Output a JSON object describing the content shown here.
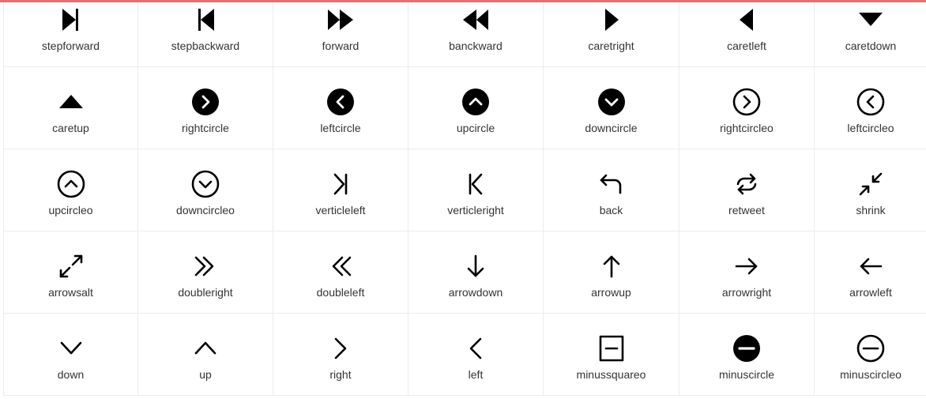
{
  "accent_color": "#ee6b6e",
  "icon_color": "#000000",
  "label_color": "#333333",
  "icons": [
    {
      "label": "stepforward",
      "icon": "step-forward-icon"
    },
    {
      "label": "stepbackward",
      "icon": "step-backward-icon"
    },
    {
      "label": "forward",
      "icon": "forward-icon"
    },
    {
      "label": "banckward",
      "icon": "backward-icon"
    },
    {
      "label": "caretright",
      "icon": "caret-right-icon"
    },
    {
      "label": "caretleft",
      "icon": "caret-left-icon"
    },
    {
      "label": "caretdown",
      "icon": "caret-down-icon"
    },
    {
      "label": "caretup",
      "icon": "caret-up-icon"
    },
    {
      "label": "rightcircle",
      "icon": "right-circle-icon"
    },
    {
      "label": "leftcircle",
      "icon": "left-circle-icon"
    },
    {
      "label": "upcircle",
      "icon": "up-circle-icon"
    },
    {
      "label": "downcircle",
      "icon": "down-circle-icon"
    },
    {
      "label": "rightcircleo",
      "icon": "right-circle-outline-icon"
    },
    {
      "label": "leftcircleo",
      "icon": "left-circle-outline-icon"
    },
    {
      "label": "upcircleo",
      "icon": "up-circle-outline-icon"
    },
    {
      "label": "downcircleo",
      "icon": "down-circle-outline-icon"
    },
    {
      "label": "verticleleft",
      "icon": "vertical-left-icon"
    },
    {
      "label": "verticleright",
      "icon": "vertical-right-icon"
    },
    {
      "label": "back",
      "icon": "back-icon"
    },
    {
      "label": "retweet",
      "icon": "retweet-icon"
    },
    {
      "label": "shrink",
      "icon": "shrink-icon"
    },
    {
      "label": "arrowsalt",
      "icon": "arrows-alt-icon"
    },
    {
      "label": "doubleright",
      "icon": "double-right-icon"
    },
    {
      "label": "doubleleft",
      "icon": "double-left-icon"
    },
    {
      "label": "arrowdown",
      "icon": "arrow-down-icon"
    },
    {
      "label": "arrowup",
      "icon": "arrow-up-icon"
    },
    {
      "label": "arrowright",
      "icon": "arrow-right-icon"
    },
    {
      "label": "arrowleft",
      "icon": "arrow-left-icon"
    },
    {
      "label": "down",
      "icon": "down-icon"
    },
    {
      "label": "up",
      "icon": "up-icon"
    },
    {
      "label": "right",
      "icon": "right-icon"
    },
    {
      "label": "left",
      "icon": "left-icon"
    },
    {
      "label": "minussquareo",
      "icon": "minus-square-outline-icon"
    },
    {
      "label": "minuscircle",
      "icon": "minus-circle-icon"
    },
    {
      "label": "minuscircleo",
      "icon": "minus-circle-outline-icon"
    }
  ]
}
